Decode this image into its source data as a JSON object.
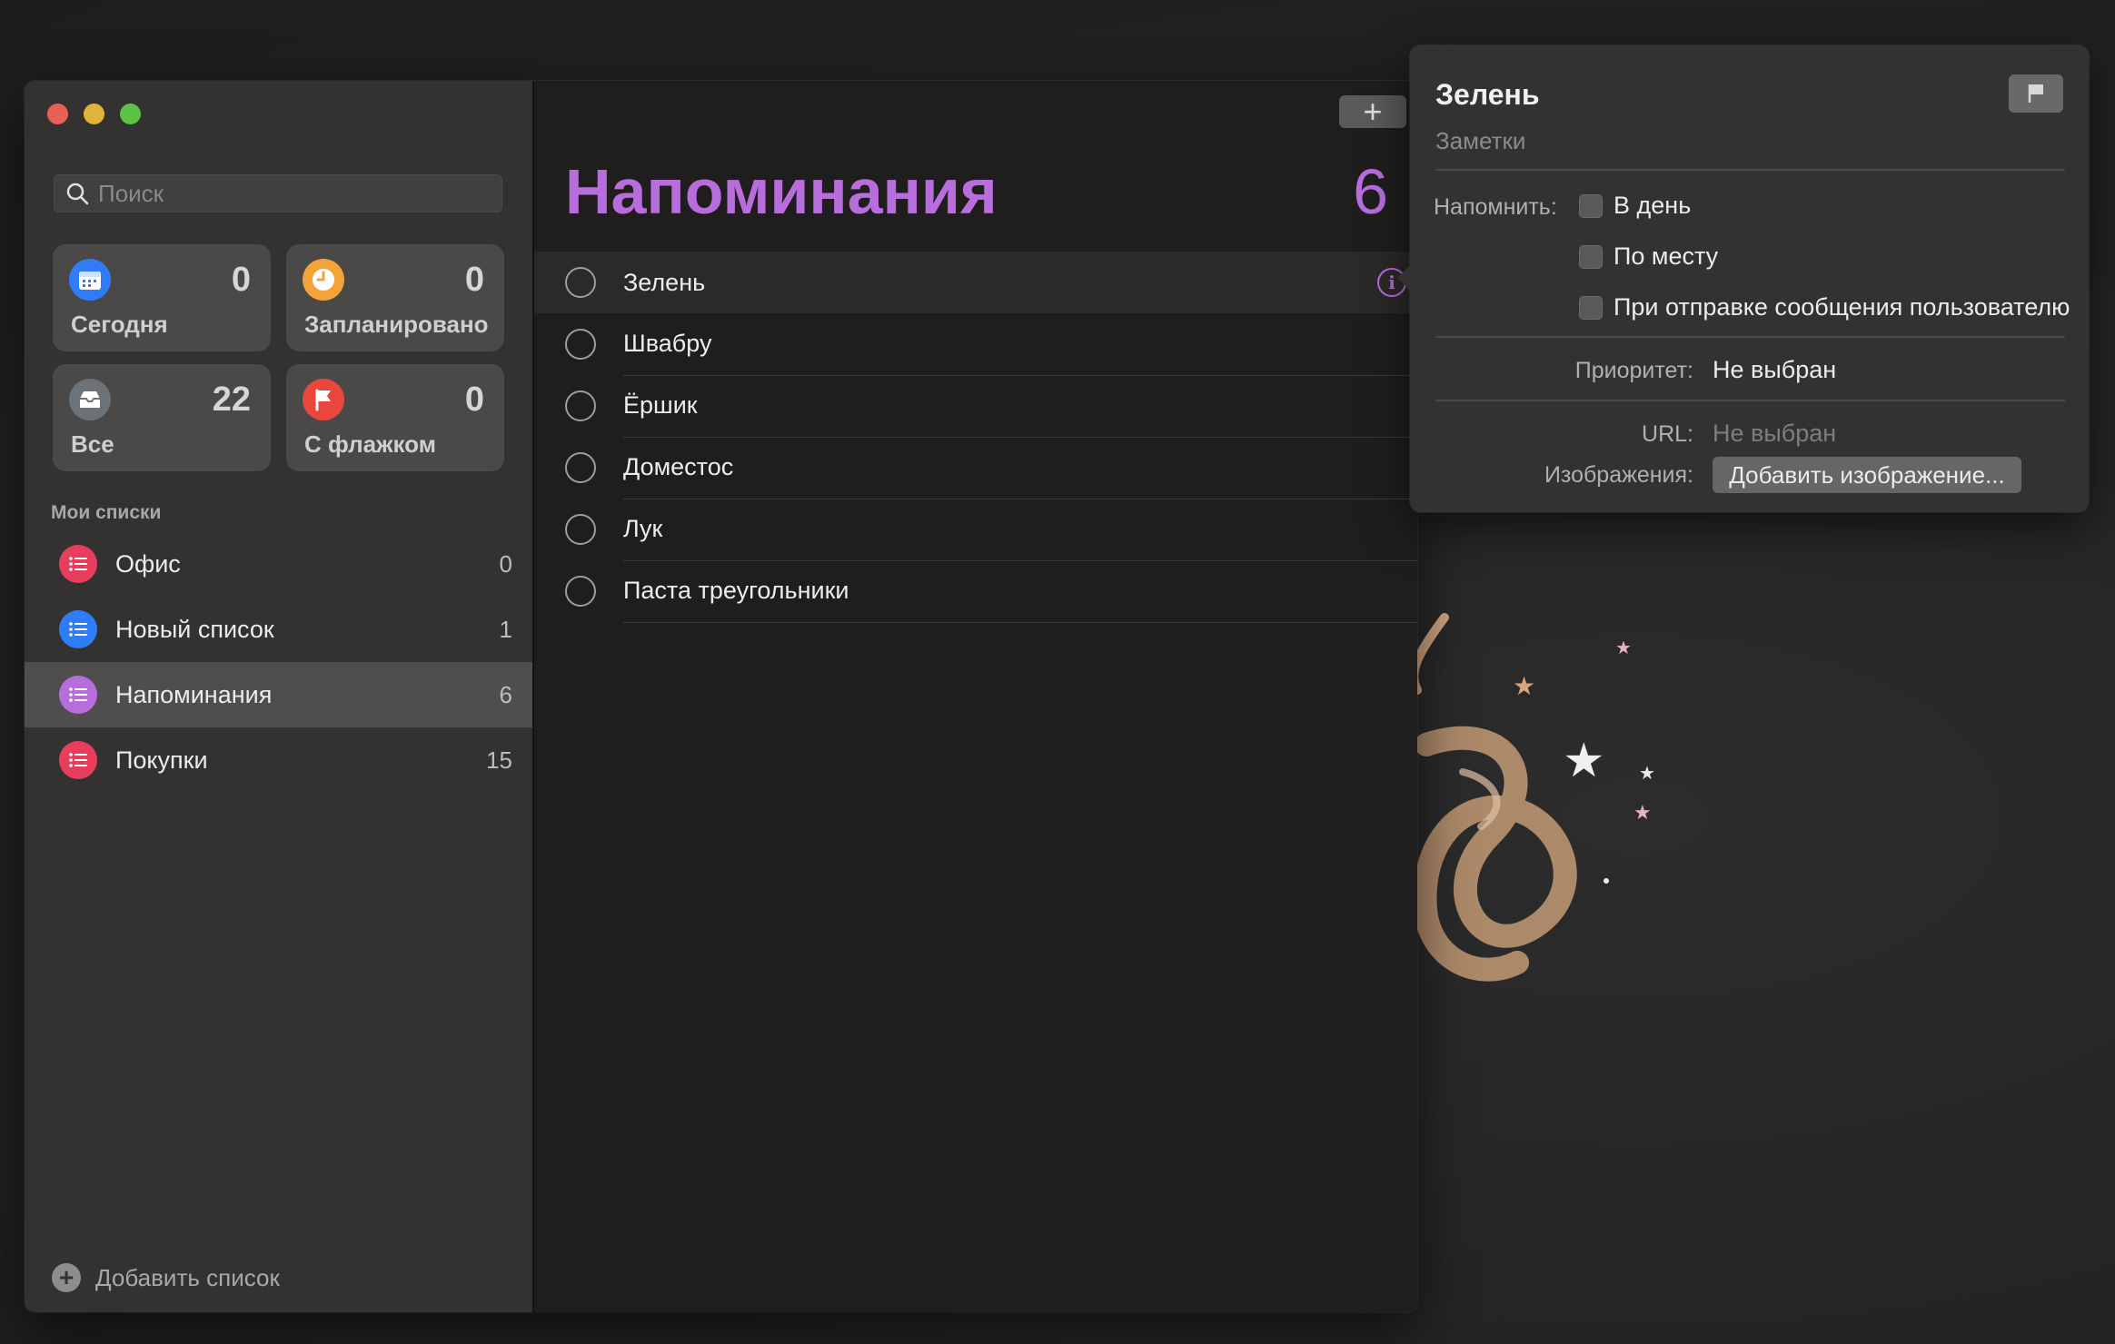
{
  "sidebar": {
    "search_placeholder": "Поиск",
    "tiles": [
      {
        "label": "Сегодня",
        "count": "0",
        "icon": "calendar-icon",
        "color": "#2f7cf6"
      },
      {
        "label": "Запланировано",
        "count": "0",
        "icon": "clock-icon",
        "color": "#f2a33a"
      },
      {
        "label": "Все",
        "count": "22",
        "icon": "tray-icon",
        "color": "#6b7379"
      },
      {
        "label": "С флажком",
        "count": "0",
        "icon": "flag-icon",
        "color": "#e9473d"
      }
    ],
    "section_label": "Мои списки",
    "lists": [
      {
        "name": "Офис",
        "count": "0",
        "color": "#e93d5e"
      },
      {
        "name": "Новый список",
        "count": "1",
        "color": "#2f7cf6"
      },
      {
        "name": "Напоминания",
        "count": "6",
        "color": "#b86ddd",
        "selected": true
      },
      {
        "name": "Покупки",
        "count": "15",
        "color": "#e93d5e"
      }
    ],
    "add_list_label": "Добавить список"
  },
  "main": {
    "add_button_label": "+",
    "title": "Напоминания",
    "count": "6",
    "accent_color": "#b86ddd",
    "tasks": [
      {
        "name": "Зелень",
        "active": true
      },
      {
        "name": "Швабру"
      },
      {
        "name": "Ёршик"
      },
      {
        "name": "Доместос"
      },
      {
        "name": "Лук"
      },
      {
        "name": "Паста треугольники"
      }
    ]
  },
  "popover": {
    "title": "Зелень",
    "notes_placeholder": "Заметки",
    "remind_label": "Напомнить:",
    "remind_options": [
      "В день",
      "По месту",
      "При отправке сообщения пользователю"
    ],
    "priority_label": "Приоритет:",
    "priority_value": "Не выбран",
    "url_label": "URL:",
    "url_value": "Не выбран",
    "images_label": "Изображения:",
    "add_image_button": "Добавить изображение..."
  }
}
